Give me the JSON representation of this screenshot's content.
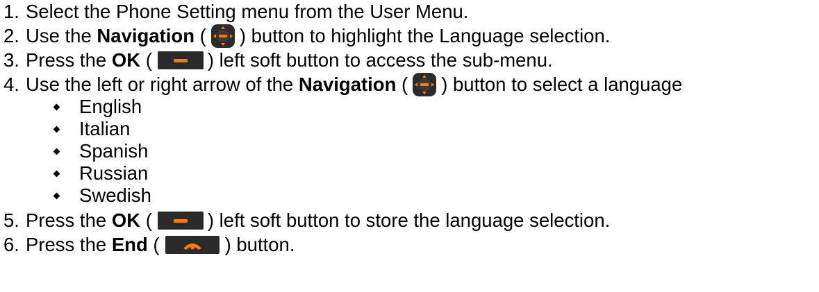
{
  "steps": [
    {
      "num": "1.",
      "text": "Select the Phone Setting menu from the User Menu."
    },
    {
      "num": "2.",
      "pre": "Use the ",
      "bold": "Navigation",
      "open": " (",
      "icon": "navigation-pad-icon",
      "close": ") button to highlight the Language selection."
    },
    {
      "num": "3.",
      "pre": "Press the ",
      "bold": "OK",
      "open": " (",
      "icon": "ok-soft-button-icon",
      "close": ") left soft button to access the sub-menu."
    },
    {
      "num": "4.",
      "pre": "Use the left or right arrow of the ",
      "bold": "Navigation",
      "open": " (",
      "icon": "navigation-pad-icon",
      "close": ") button to select a language"
    },
    {
      "num": "5.",
      "pre": "Press the ",
      "bold": "OK",
      "open": " (",
      "icon": "ok-soft-button-icon",
      "close": ") left soft button to store the language selection."
    },
    {
      "num": "6.",
      "pre": "Press the ",
      "bold": "End",
      "open": " (",
      "icon": "end-call-button-icon",
      "close": ") button."
    }
  ],
  "languages": [
    "English",
    "Italian",
    "Spanish",
    "Russian",
    "Swedish"
  ],
  "colors": {
    "text": "#000000",
    "icon_dark": "#2a2a2a",
    "icon_orange": "#ff7a00"
  }
}
